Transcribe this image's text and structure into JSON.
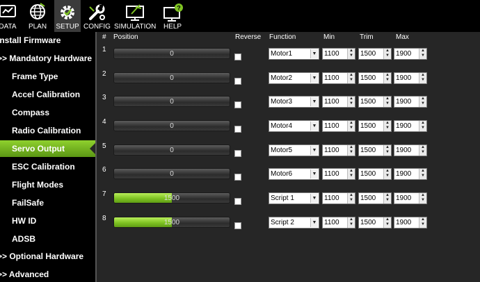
{
  "toolbar": {
    "buttons": [
      {
        "label": "DATA",
        "icon": "data-screen-icon"
      },
      {
        "label": "PLAN",
        "icon": "globe-icon"
      },
      {
        "label": "SETUP",
        "icon": "gear-icon"
      },
      {
        "label": "CONFIG",
        "icon": "wrench-icon"
      },
      {
        "label": "SIMULATION",
        "icon": "monitor-plane-icon"
      },
      {
        "label": "HELP",
        "icon": "help-monitor-icon"
      }
    ],
    "active": "SETUP"
  },
  "sidebar": {
    "items": [
      {
        "label": "Install Firmware"
      },
      {
        "label": ">> Mandatory Hardware"
      },
      {
        "label": "Frame Type"
      },
      {
        "label": "Accel Calibration"
      },
      {
        "label": "Compass"
      },
      {
        "label": "Radio Calibration"
      },
      {
        "label": "Servo Output"
      },
      {
        "label": "ESC Calibration"
      },
      {
        "label": "Flight Modes"
      },
      {
        "label": "FailSafe"
      },
      {
        "label": "HW ID"
      },
      {
        "label": "ADSB"
      },
      {
        "label": ">> Optional Hardware"
      },
      {
        "label": ">> Advanced"
      }
    ],
    "active": "Servo Output"
  },
  "table": {
    "headers": {
      "num": "#",
      "position": "Position",
      "reverse": "Reverse",
      "function": "Function",
      "min": "Min",
      "trim": "Trim",
      "max": "Max"
    },
    "rows": [
      {
        "num": "1",
        "position": "0",
        "fill_fraction": 0,
        "reverse": false,
        "function": "Motor1",
        "min": "1100",
        "trim": "1500",
        "max": "1900"
      },
      {
        "num": "2",
        "position": "0",
        "fill_fraction": 0,
        "reverse": false,
        "function": "Motor2",
        "min": "1100",
        "trim": "1500",
        "max": "1900"
      },
      {
        "num": "3",
        "position": "0",
        "fill_fraction": 0,
        "reverse": false,
        "function": "Motor3",
        "min": "1100",
        "trim": "1500",
        "max": "1900"
      },
      {
        "num": "4",
        "position": "0",
        "fill_fraction": 0,
        "reverse": false,
        "function": "Motor4",
        "min": "1100",
        "trim": "1500",
        "max": "1900"
      },
      {
        "num": "5",
        "position": "0",
        "fill_fraction": 0,
        "reverse": false,
        "function": "Motor5",
        "min": "1100",
        "trim": "1500",
        "max": "1900"
      },
      {
        "num": "6",
        "position": "0",
        "fill_fraction": 0,
        "reverse": false,
        "function": "Motor6",
        "min": "1100",
        "trim": "1500",
        "max": "1900"
      },
      {
        "num": "7",
        "position": "1500",
        "fill_fraction": 0.5,
        "reverse": false,
        "function": "Script 1",
        "min": "1100",
        "trim": "1500",
        "max": "1900"
      },
      {
        "num": "8",
        "position": "1500",
        "fill_fraction": 0.5,
        "reverse": false,
        "function": "Script 2",
        "min": "1100",
        "trim": "1500",
        "max": "1900"
      }
    ]
  },
  "colors": {
    "accent_green": "#7fc323",
    "background": "#262626",
    "sidebar_bg": "#000000"
  }
}
